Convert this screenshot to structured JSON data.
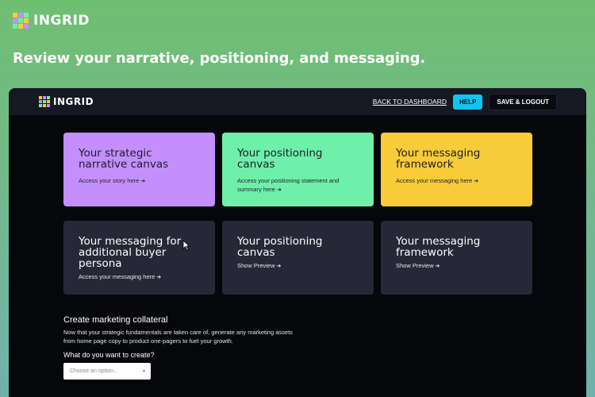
{
  "brand": {
    "name": "INGRID"
  },
  "page": {
    "heading": "Review your narrative, positioning, and messaging."
  },
  "header": {
    "back_link": "BACK TO DASHBOARD",
    "help": "HELP",
    "logout": "SAVE & LOGOUT"
  },
  "colors": {
    "purple": "#c48ffb",
    "green": "#6ef0aa",
    "yellow": "#f8cb38",
    "dark_card": "#262838",
    "help_button": "#10c6f0"
  },
  "cards": [
    {
      "title": "Your strategic\nnarrative canvas",
      "subtitle": "Access your story here"
    },
    {
      "title": "Your positioning\ncanvas",
      "subtitle": "Access your positioning statement and\nsummary here"
    },
    {
      "title": "Your messaging\nframework",
      "subtitle": "Access your messaging here"
    },
    {
      "title": "Your messaging for\nadditional buyer\npersona",
      "subtitle": "Access your messaging here"
    },
    {
      "title": "Your positioning\ncanvas",
      "subtitle": "Show Preview"
    },
    {
      "title": "Your messaging\nframework",
      "subtitle": "Show Preview"
    }
  ],
  "collateral": {
    "title": "Create marketing collateral",
    "description": "Now that your strategic fundamentals are taken care of, generate any marketing assets from home page copy to product one-pagers to fuel your growth.",
    "question": "What do you want to create?",
    "select_placeholder": "Choose an option..."
  }
}
